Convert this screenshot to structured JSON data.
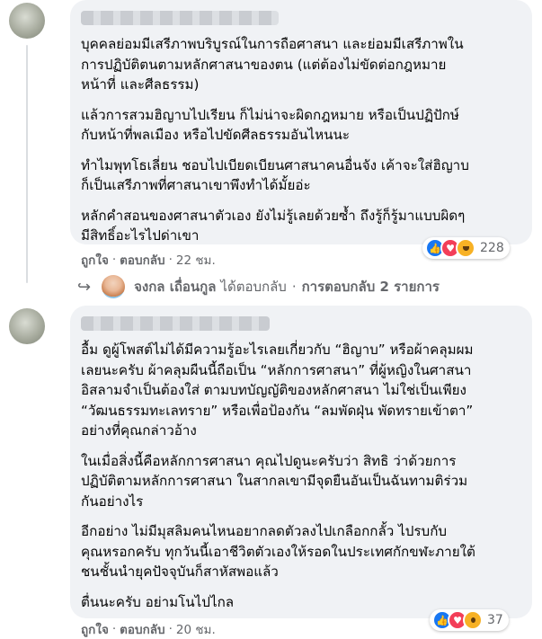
{
  "comments": [
    {
      "paragraphs": [
        "บุคคลย่อมมีเสรีภาพบริบูรณ์ในการถือศาสนา และย่อมมีเสรีภาพใน\nการปฏิบัติตนตามหลักศาสนาของตน (แต่ต้องไม่ขัดต่อกฎหมาย\nหน้าที่ และศีลธรรม)",
        "แล้วการสวมฮิญาบไปเรียน ก็ไม่น่าจะผิดกฎหมาย หรือเป็นปฏิปักษ์\nกับหน้าที่พลเมือง หรือไปขัดศีลธรรมอันไหนนะ",
        "ทำไมพุทโธเลี่ยน ชอบไปเบียดเบียนศาสนาคนอื่นจัง เค้าจะใส่ฮิญาบ\nก็เป็นเสรีภาพที่ศาสนาเขาพึงทำได้มั้ยอ่ะ",
        "หลักคำสอนของศาสนาตัวเอง ยังไม่รู้เลยด้วยซ้ำ ถึงรู้ก็รู้มาแบบผิดๆ\nมีสิทธิ์อะไรไปด่าเขา"
      ],
      "like_label": "ถูกใจ",
      "reply_label": "ตอบกลับ",
      "time": "22 ชม.",
      "reaction_count": "228",
      "reactions": [
        "like",
        "love",
        "haha"
      ]
    },
    {
      "paragraphs": [
        "อื้ม ดูผู้โพสต์ไม่ได้มีความรู้อะไรเลยเกี่ยวกับ “ฮิญาบ” หรือผ้าคลุมผม\nเลยนะครับ ผ้าคลุมผืนนี้ถือเป็น “หลักการศาสนา” ที่ผู้หญิงในศาสนา\nอิสลามจำเป็นต้องใส่ ตามบทบัญญัติของหลักศาสนา ไม่ใช่เป็นเพียง\n“วัฒนธรรมทะเลทราย” หรือเพื่อป้องกัน “ลมพัดฝุ่น พัดทรายเข้าตา”\nอย่างที่คุณกล่าวอ้าง",
        "ในเมื่อสิ่งนี้คือหลักการศาสนา คุณไปดูนะครับว่า สิทธิ ว่าด้วยการ\nปฏิบัติตามหลักการศาสนา ในสากลเขามีจุดยืนอันเป็นฉันทามติร่วม\nกันอย่างไร",
        "อีกอย่าง ไม่มีมุสลิมคนไหนอยากลดตัวลงไปเกลือกกลั้ว ไปรบกับ\nคุณหรอกครับ ทุกวันนี้เอาชีวิตตัวเองให้รอดในประเทศกักขฬะภายใต้\nชนชั้นนำยุคปัจจุบันก็สาหัสพอแล้ว",
        "ตื่นนะครับ อย่ามโนไปไกล"
      ],
      "like_label": "ถูกใจ",
      "reply_label": "ตอบกลับ",
      "time": "20 ชม.",
      "reaction_count": "37",
      "reactions": [
        "like",
        "love",
        "wow"
      ]
    }
  ],
  "reply_summary": {
    "name": "จงกล เถื่อนกูล",
    "action": "ได้ตอบกลับ",
    "summary": "การตอบกลับ 2 รายการ"
  },
  "colors": {
    "like": "#1877f2",
    "love": "#f33e58",
    "yellow": "#f7b125",
    "bubble": "#f0f2f5",
    "meta": "#65676b"
  },
  "icons": [
    "profile-avatar",
    "reply-arrow-icon",
    "like-reaction-icon",
    "love-reaction-icon",
    "haha-reaction-icon",
    "wow-reaction-icon"
  ]
}
